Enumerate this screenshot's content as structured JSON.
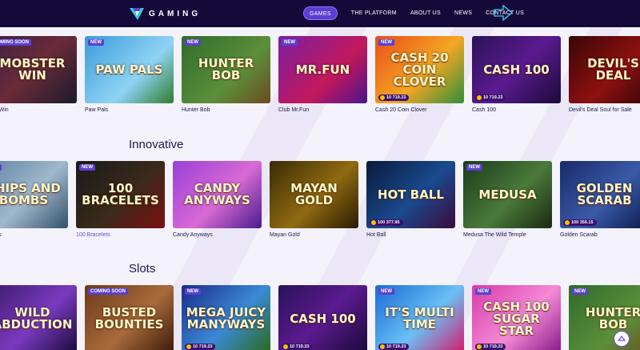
{
  "header": {
    "logo_text": "GAMING",
    "nav": [
      "GAMES",
      "THE PLATFORM",
      "ABOUT US",
      "NEWS",
      "CONTACT US"
    ]
  },
  "sections": [
    {
      "title": "",
      "games": [
        {
          "thumb": "MOBSTER WIN",
          "name": "ster Win",
          "badge": "COMING SOON",
          "jackpot": "",
          "bg": "linear-gradient(135deg,#3a2140,#6b2a3a 50%,#1b1b2a)"
        },
        {
          "thumb": "PAW PALS",
          "name": "Paw Pals",
          "badge": "NEW",
          "jackpot": "",
          "bg": "linear-gradient(135deg,#3a9bd8,#8fd3f5 60%,#2e7c2e)"
        },
        {
          "thumb": "HUNTER BOB",
          "name": "Hunter Bob",
          "badge": "NEW",
          "jackpot": "",
          "bg": "linear-gradient(135deg,#2f6b2a,#5c8f3a 60%,#6b4a20)"
        },
        {
          "thumb": "MR.FUN",
          "name": "Club Mr.Fun",
          "badge": "NEW",
          "jackpot": "",
          "bg": "linear-gradient(135deg,#7b1fa2,#c2185b 60%,#4a148c)"
        },
        {
          "thumb": "CASH 20 COIN CLOVER",
          "name": "Cash 20 Coin Clover",
          "badge": "NEW",
          "jackpot": "10 719.23",
          "bg": "linear-gradient(135deg,#e84d1a,#f5a623 55%,#2f8f3a)"
        },
        {
          "thumb": "CASH 100",
          "name": "Cash 100",
          "badge": "",
          "jackpot": "10 719.23",
          "bg": "linear-gradient(135deg,#2a1258,#5b1a8f 50%,#1a0b3a)"
        },
        {
          "thumb": "DEVIL'S DEAL",
          "name": "Devil's Deal Soul for Sale",
          "badge": "",
          "jackpot": "",
          "bg": "linear-gradient(135deg,#3a0606,#8e1010 55%,#2a0404)"
        }
      ]
    },
    {
      "title": "Innovative",
      "games": [
        {
          "thumb": "SHIPS AND BOMBS",
          "name": "d Bombs",
          "badge": "SOON",
          "jackpot": "",
          "bg": "linear-gradient(135deg,#5a7fa0,#9fb8cc 55%,#34506a)"
        },
        {
          "thumb": "100 BRACELETS",
          "name": "100 Bracelets",
          "badge": "NEW",
          "jackpot": "",
          "bg": "linear-gradient(135deg,#1a1a1a,#3a2a1a 55%,#7a1010)"
        },
        {
          "thumb": "CANDY ANYWAYS",
          "name": "Candy Anyways",
          "badge": "",
          "jackpot": "",
          "bg": "linear-gradient(135deg,#9b3fd6,#d86ad6 55%,#4a1a8a)"
        },
        {
          "thumb": "MAYAN GOLD",
          "name": "Mayan Gold",
          "badge": "",
          "jackpot": "",
          "bg": "linear-gradient(135deg,#3a2a06,#8f6a10 55%,#2a1a04)"
        },
        {
          "thumb": "HOT BALL",
          "name": "Hot Ball",
          "badge": "",
          "jackpot": "100 377.95",
          "bg": "linear-gradient(135deg,#0a1a3a,#1a4a8f 55%,#3a0a3a)"
        },
        {
          "thumb": "MEDUSA",
          "name": "Medusa The Wild Temple",
          "badge": "NEW",
          "jackpot": "",
          "bg": "linear-gradient(135deg,#1a3a1a,#4a7a3a 55%,#1a2a10)"
        },
        {
          "thumb": "GOLDEN SCARAB",
          "name": "Golden Scarab",
          "badge": "",
          "jackpot": "100 356.15",
          "bg": "linear-gradient(135deg,#1a2a6a,#3a5aa8 55%,#0a1a4a)"
        }
      ]
    },
    {
      "title": "Slots",
      "games": [
        {
          "thumb": "WILD ABDUCTION",
          "name": "",
          "badge": "",
          "jackpot": "",
          "bg": "linear-gradient(135deg,#3a1a6a,#7a3ac0 55%,#1a0a3a)"
        },
        {
          "thumb": "BUSTED BOUNTIES",
          "name": "",
          "badge": "COMING SOON",
          "jackpot": "",
          "bg": "linear-gradient(135deg,#6a3a1a,#a86a3a 55%,#3a1a0a)"
        },
        {
          "thumb": "MEGA JUICY MANYWAYS",
          "name": "",
          "badge": "NEW",
          "jackpot": "10 719.23",
          "bg": "linear-gradient(135deg,#1a2a8a,#3a8ad6 55%,#2a6a1a)"
        },
        {
          "thumb": "CASH 100",
          "name": "",
          "badge": "",
          "jackpot": "10 719.23",
          "bg": "linear-gradient(135deg,#2a1258,#5b1a8f 50%,#1a0b3a)"
        },
        {
          "thumb": "IT'S MULTI TIME",
          "name": "",
          "badge": "NEW",
          "jackpot": "10 719.23",
          "bg": "linear-gradient(135deg,#1a6ad6,#6ac0f5 55%,#d61a6a)"
        },
        {
          "thumb": "CASH 100 SUGAR STAR",
          "name": "",
          "badge": "NEW",
          "jackpot": "10 719.23",
          "bg": "linear-gradient(135deg,#d63aa8,#f58ad6 55%,#8a1a8a)"
        },
        {
          "thumb": "HUNTER BOB",
          "name": "",
          "badge": "NEW",
          "jackpot": "",
          "bg": "linear-gradient(135deg,#2f6b2a,#5c8f3a 60%,#6b4a20)"
        }
      ]
    }
  ],
  "colors": {
    "header": "#15093a",
    "accent": "#5a3fd1",
    "background": "#f4f2fb"
  }
}
